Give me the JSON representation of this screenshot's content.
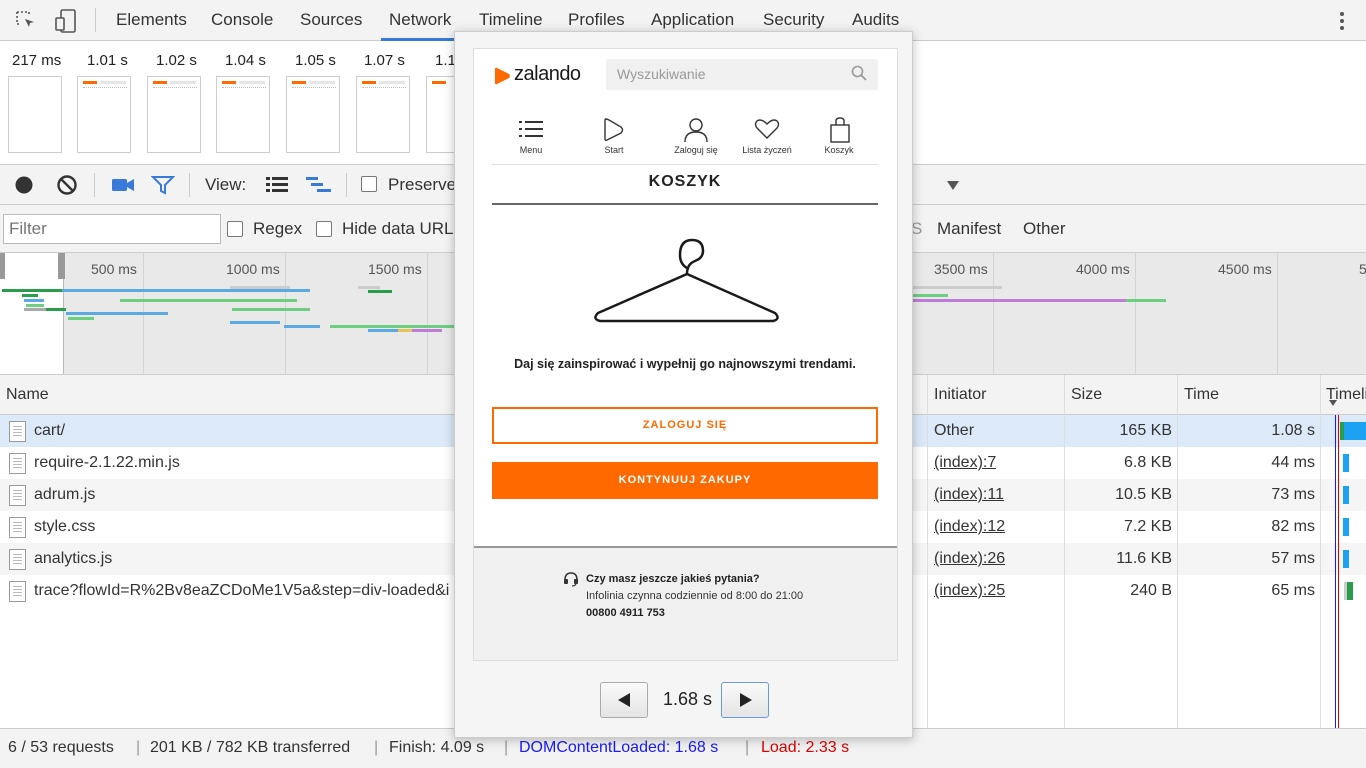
{
  "tabs": [
    "Elements",
    "Console",
    "Sources",
    "Network",
    "Timeline",
    "Profiles",
    "Application",
    "Security",
    "Audits"
  ],
  "active_tab": "Network",
  "filmstrip": {
    "times": [
      "217 ms",
      "1.01 s",
      "1.02 s",
      "1.04 s",
      "1.05 s",
      "1.07 s",
      "1.1"
    ]
  },
  "toolbar": {
    "view_label": "View:",
    "preserve_label": "Preserve"
  },
  "filterbar": {
    "filter_placeholder": "Filter",
    "regex_label": "Regex",
    "hide_data_urls_label": "Hide data URL",
    "type_fragment": "S",
    "types": [
      "Manifest",
      "Other"
    ]
  },
  "overview": {
    "labels_left": [
      "500 ms",
      "1000 ms",
      "1500 ms"
    ],
    "labels_right": [
      "3500 ms",
      "4000 ms",
      "4500 ms",
      "5"
    ]
  },
  "table": {
    "headers": {
      "name": "Name",
      "initiator": "Initiator",
      "size": "Size",
      "time": "Time",
      "timeline": "Timeline"
    },
    "rows": [
      {
        "name": "cart/",
        "initiator": "Other",
        "size": "165 KB",
        "time": "1.08 s"
      },
      {
        "name": "require-2.1.22.min.js",
        "initiator": "(index):7",
        "size": "6.8 KB",
        "time": "44 ms"
      },
      {
        "name": "adrum.js",
        "initiator": "(index):11",
        "size": "10.5 KB",
        "time": "73 ms"
      },
      {
        "name": "style.css",
        "initiator": "(index):12",
        "size": "7.2 KB",
        "time": "82 ms"
      },
      {
        "name": "analytics.js",
        "initiator": "(index):26",
        "size": "11.6 KB",
        "time": "57 ms"
      },
      {
        "name": "trace?flowId=R%2Bv8eaZCDoMe1V5a&step=div-loaded&i",
        "initiator": "(index):25",
        "size": "240 B",
        "time": "65 ms"
      }
    ]
  },
  "status": {
    "requests": "6 / 53 requests",
    "transferred": "201 KB / 782 KB transferred",
    "finish": "Finish: 4.09 s",
    "domcontentloaded": "DOMContentLoaded: 1.68 s",
    "load": "Load: 2.33 s"
  },
  "popup": {
    "logo": "zalando",
    "search_placeholder": "Wyszukiwanie",
    "nav": [
      "Menu",
      "Start",
      "Zaloguj się",
      "Lista życzeń",
      "Koszyk"
    ],
    "heading": "KOSZYK",
    "message": "Daj się zainspirować i wypełnij go najnowszymi trendami.",
    "login_button": "ZALOGUJ SIĘ",
    "continue_button": "KONTYNUUJ ZAKUPY",
    "help_title": "Czy masz jeszcze jakieś pytania?",
    "help_hours": "Infolinia czynna codziennie od 8:00 do 21:00",
    "help_phone": "00800 4911 753",
    "frame_time": "1.68 s"
  },
  "colors": {
    "accent": "#3879d9",
    "brand_orange": "#ff6900",
    "domcontentloaded_blue": "#1a1aff",
    "load_red": "#e00000"
  }
}
